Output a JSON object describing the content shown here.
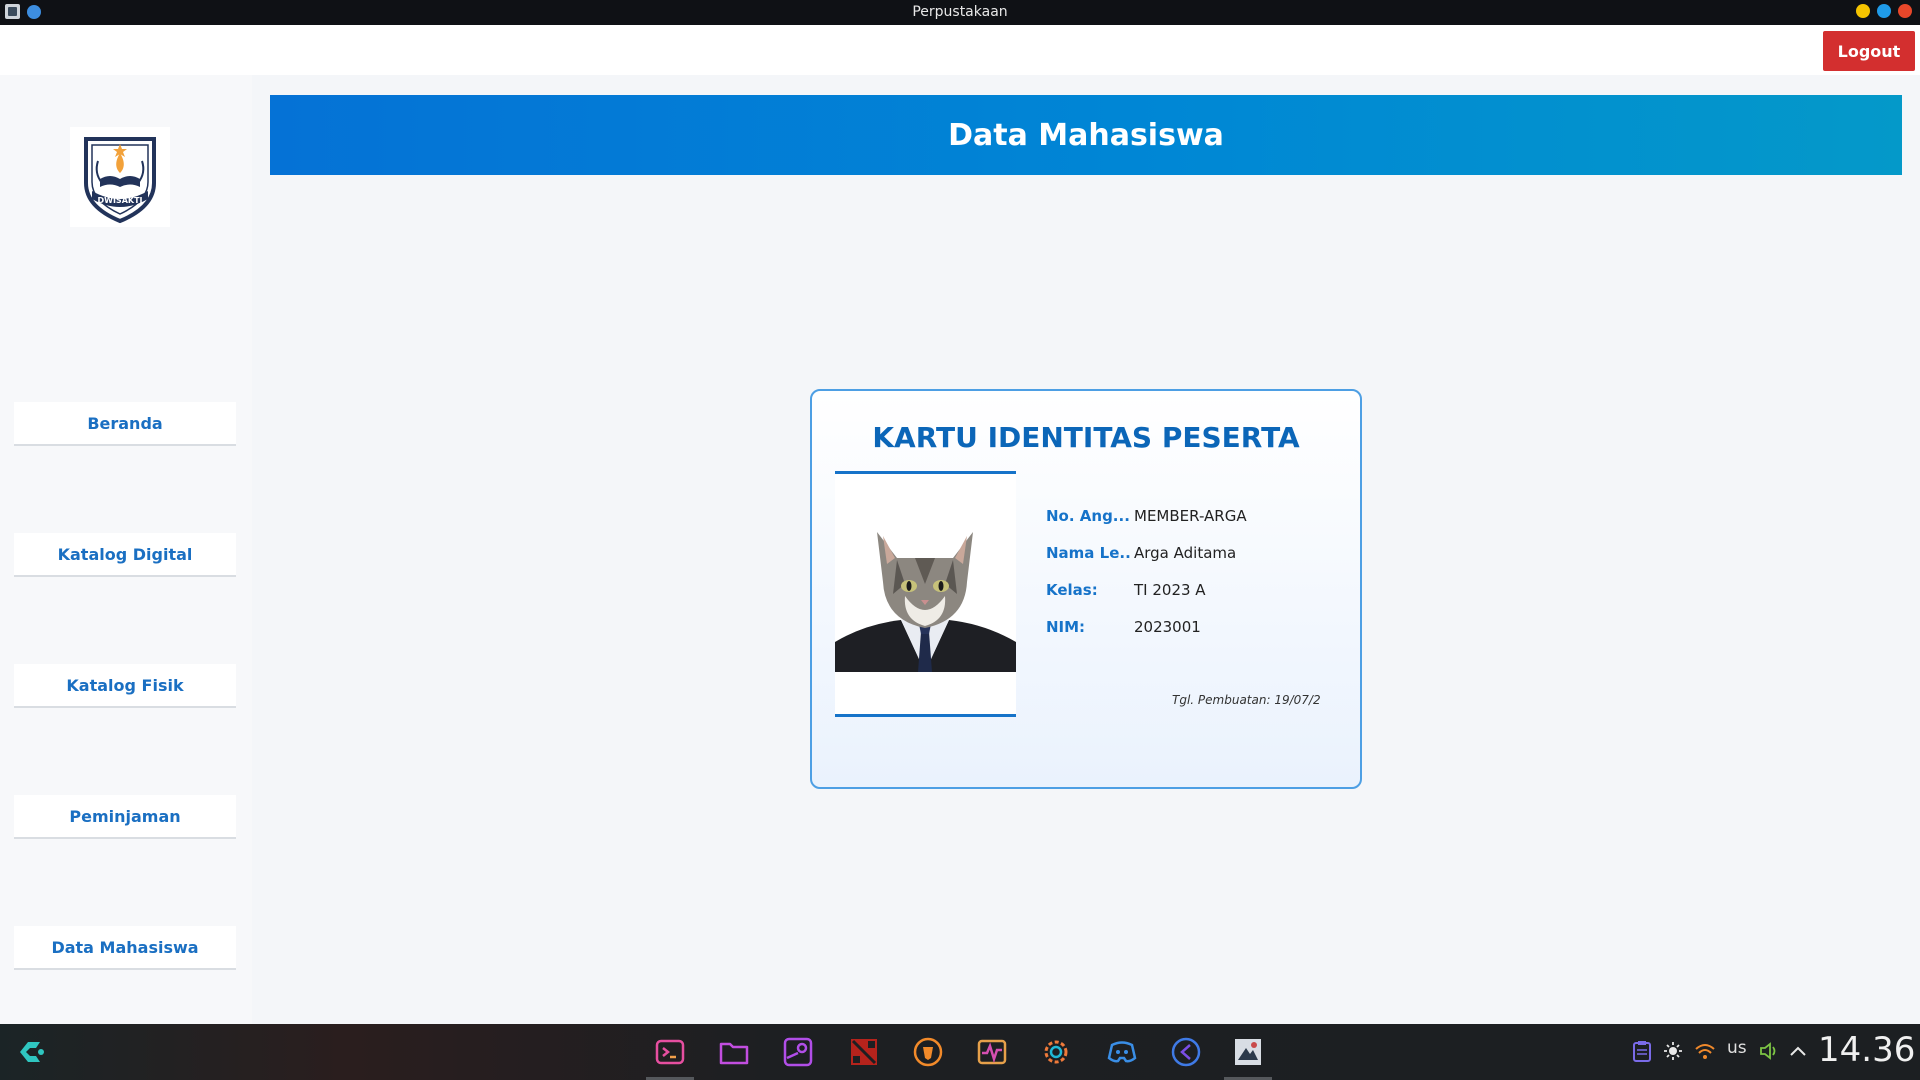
{
  "window": {
    "title": "Perpustakaan"
  },
  "header": {
    "logout_label": "Logout"
  },
  "sidebar": {
    "logo_text": "DWISAKTI",
    "items": [
      {
        "label": "Beranda"
      },
      {
        "label": "Katalog Digital"
      },
      {
        "label": "Katalog Fisik"
      },
      {
        "label": "Peminjaman"
      },
      {
        "label": "Data Mahasiswa"
      }
    ]
  },
  "main": {
    "banner_title": "Data Mahasiswa",
    "card": {
      "title": "KARTU IDENTITAS PESERTA",
      "fields": [
        {
          "label": "No. Ang...",
          "value": "MEMBER-ARGA"
        },
        {
          "label": "Nama Le...",
          "value": "Arga Aditama"
        },
        {
          "label": "Kelas:",
          "value": "TI 2023 A"
        },
        {
          "label": "NIM:",
          "value": "2023001"
        }
      ],
      "created_date": "Tgl. Pembuatan: 19/07/2"
    }
  },
  "taskbar": {
    "apps": [
      "terminal-icon",
      "files-icon",
      "steam-icon",
      "dota-icon",
      "brave-icon",
      "monitor-icon",
      "settings-icon",
      "discord-icon",
      "vscode-icon",
      "app-icon"
    ],
    "tray": {
      "keyboard_layout": "us"
    },
    "clock": "14.36"
  },
  "colors": {
    "accent": "#1673c9",
    "banner_start": "#0572d6",
    "banner_end": "#0499c9",
    "logout": "#d32f2f"
  }
}
